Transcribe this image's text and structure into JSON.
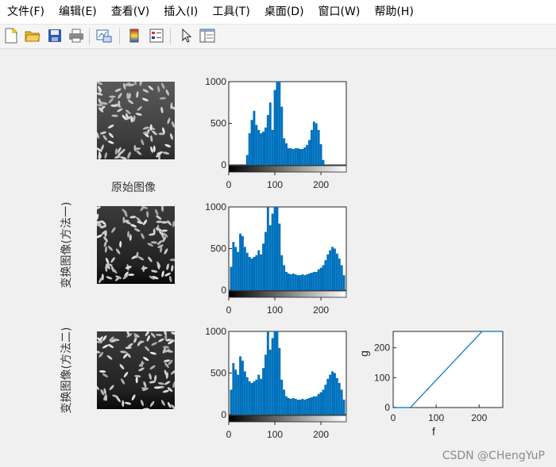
{
  "menu": [
    "文件(F)",
    "编辑(E)",
    "查看(V)",
    "插入(I)",
    "工具(T)",
    "桌面(D)",
    "窗口(W)",
    "帮助(H)"
  ],
  "toolbar": [
    "new-figure-icon",
    "open-file-icon",
    "save-icon",
    "print-icon",
    "link-plot-icon",
    "insert-colorbar-icon",
    "insert-legend-icon",
    "edit-plot-arrow-icon",
    "property-inspector-icon"
  ],
  "figure": {
    "title_original": "原始图像",
    "ylabel_method1": "变换图像(方法一)",
    "ylabel_method2": "变换图像(方法二)",
    "watermark": "CSDN @CHengYuP"
  },
  "chart_data": [
    {
      "type": "bar",
      "name": "histogram-original",
      "xticks": [
        "0",
        "100",
        "200"
      ],
      "yticks": [
        "0",
        "500",
        "1000"
      ],
      "xlim": [
        0,
        255
      ],
      "ylim": [
        0,
        1000
      ],
      "x": [
        40,
        45,
        50,
        55,
        60,
        65,
        70,
        75,
        80,
        85,
        90,
        95,
        100,
        105,
        110,
        115,
        120,
        125,
        130,
        135,
        140,
        145,
        150,
        155,
        160,
        165,
        170,
        175,
        180,
        185,
        190,
        195,
        200,
        205
      ],
      "values": [
        120,
        380,
        540,
        650,
        480,
        420,
        380,
        400,
        450,
        600,
        750,
        420,
        900,
        1000,
        1000,
        700,
        320,
        260,
        200,
        200,
        190,
        200,
        200,
        190,
        190,
        210,
        240,
        300,
        420,
        520,
        500,
        420,
        250,
        60
      ]
    },
    {
      "type": "bar",
      "name": "histogram-method1",
      "xticks": [
        "0",
        "100",
        "200"
      ],
      "yticks": [
        "0",
        "500",
        "1000"
      ],
      "xlim": [
        0,
        255
      ],
      "ylim": [
        0,
        1000
      ],
      "x": [
        5,
        10,
        15,
        20,
        25,
        30,
        35,
        40,
        45,
        50,
        55,
        60,
        65,
        70,
        75,
        80,
        85,
        90,
        95,
        100,
        105,
        110,
        115,
        120,
        125,
        130,
        135,
        140,
        145,
        150,
        155,
        160,
        165,
        170,
        175,
        180,
        185,
        190,
        195,
        200,
        205,
        210,
        215,
        220,
        225,
        230,
        235,
        240,
        245,
        250
      ],
      "values": [
        280,
        580,
        520,
        460,
        680,
        650,
        520,
        450,
        400,
        380,
        400,
        420,
        480,
        430,
        560,
        700,
        1000,
        780,
        920,
        1000,
        1000,
        800,
        420,
        300,
        220,
        200,
        190,
        200,
        190,
        180,
        180,
        190,
        180,
        190,
        200,
        210,
        220,
        220,
        250,
        270,
        300,
        360,
        430,
        480,
        520,
        500,
        440,
        380,
        300,
        180
      ]
    },
    {
      "type": "bar",
      "name": "histogram-method2",
      "xticks": [
        "0",
        "100",
        "200"
      ],
      "yticks": [
        "0",
        "500",
        "1000"
      ],
      "xlim": [
        0,
        255
      ],
      "ylim": [
        0,
        1000
      ],
      "x": [
        5,
        10,
        15,
        20,
        25,
        30,
        35,
        40,
        45,
        50,
        55,
        60,
        65,
        70,
        75,
        80,
        85,
        90,
        95,
        100,
        105,
        110,
        115,
        120,
        125,
        130,
        135,
        140,
        145,
        150,
        155,
        160,
        165,
        170,
        175,
        180,
        185,
        190,
        195,
        200,
        205,
        210,
        215,
        220,
        225,
        230,
        235,
        240,
        245,
        250
      ],
      "values": [
        300,
        620,
        540,
        480,
        700,
        650,
        520,
        450,
        400,
        380,
        400,
        420,
        480,
        430,
        560,
        720,
        1000,
        780,
        920,
        1000,
        1000,
        800,
        420,
        300,
        220,
        200,
        190,
        200,
        190,
        180,
        180,
        190,
        180,
        190,
        200,
        210,
        220,
        220,
        250,
        270,
        300,
        360,
        430,
        480,
        520,
        500,
        440,
        380,
        300,
        180
      ]
    },
    {
      "type": "line",
      "name": "transform-curve",
      "xlabel": "f",
      "ylabel": "g",
      "xticks": [
        "0",
        "100",
        "200"
      ],
      "yticks": [
        "0",
        "100",
        "200"
      ],
      "xlim": [
        0,
        255
      ],
      "ylim": [
        0,
        255
      ],
      "x": [
        0,
        40,
        207,
        255
      ],
      "y": [
        0,
        0,
        255,
        255
      ]
    }
  ],
  "colors": {
    "bar": "#0072bd",
    "line": "#0072bd",
    "background": "#f0f0f0"
  }
}
